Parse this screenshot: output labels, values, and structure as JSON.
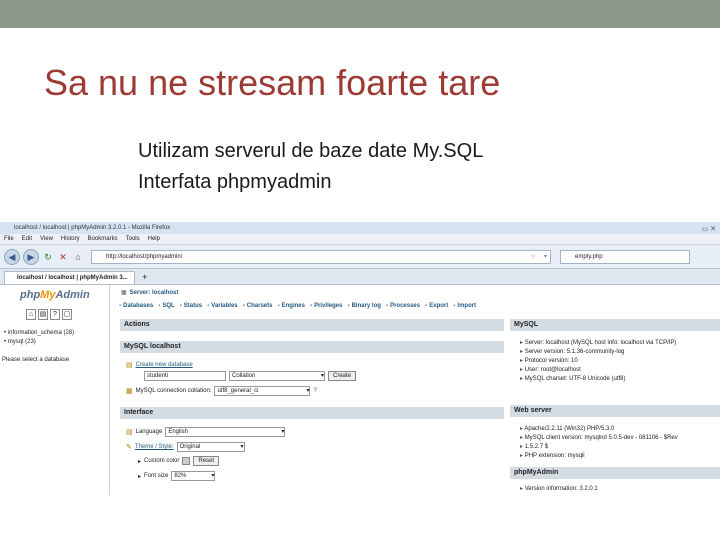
{
  "slide": {
    "title": "Sa nu ne stresam foarte tare",
    "bullets": [
      "Utilizam serverul de baze date My.SQL",
      "Interfata phpmyadmin"
    ]
  },
  "browser": {
    "window_title": "localhost / localhost | phpMyAdmin 3.2.0.1 - Mozilla Firefox",
    "menu": [
      "File",
      "Edit",
      "View",
      "History",
      "Bookmarks",
      "Tools",
      "Help"
    ],
    "url": "http://localhost/phpmyadmin/",
    "search_placeholder": "empty.php",
    "tab_label": "localhost / localhost | phpMyAdmin 3..."
  },
  "pma": {
    "logo_php": "php",
    "logo_my": "My",
    "logo_admin": "Admin",
    "databases": [
      "information_schema (28)",
      "mysql (23)"
    ],
    "select_db": "Please select a database",
    "server_crumb": "Server: localhost",
    "tabs": [
      "Databases",
      "SQL",
      "Status",
      "Variables",
      "Charsets",
      "Engines",
      "Privileges",
      "Binary log",
      "Processes",
      "Export",
      "Import"
    ],
    "actions_header": "Actions",
    "mysql_local_header": "MySQL localhost",
    "create_db_label": "Create new database",
    "create_db_value": "studenti",
    "collation_value": "Collation",
    "create_button": "Create",
    "connection_label": "MySQL connection collation:",
    "connection_value": "utf8_general_ci",
    "interface_header": "Interface",
    "language_label": "Language",
    "language_value": "English",
    "theme_label": "Theme / Style:",
    "theme_value": "Original",
    "custom_color_label": "Custom color",
    "reset_button": "Reset",
    "font_size_label": "Font size",
    "font_size_value": "82%",
    "mysql_header": "MySQL",
    "mysql_info": [
      "Server: localhost (MySQL host info: localhost via TCP/IP)",
      "Server version: 5.1.36-community-log",
      "Protocol version: 10",
      "User: root@localhost",
      "MySQL charset: UTF-8 Unicode (utf8)"
    ],
    "webserver_header": "Web server",
    "webserver_info": [
      "Apache/2.2.11 (Win32) PHP/5.3.0",
      "MySQL client version: mysqlnd 5.0.5-dev - 081106 - $Rev",
      "1.5.2.7 $",
      "PHP extension: mysqli"
    ],
    "pma_header": "phpMyAdmin",
    "pma_info": [
      "Version information: 3.2.0.1"
    ]
  },
  "colors": {
    "title": "#9b3b34",
    "topbar": "#8a998a",
    "pma_header": "#d3dce3",
    "pma_link": "#235a81"
  }
}
